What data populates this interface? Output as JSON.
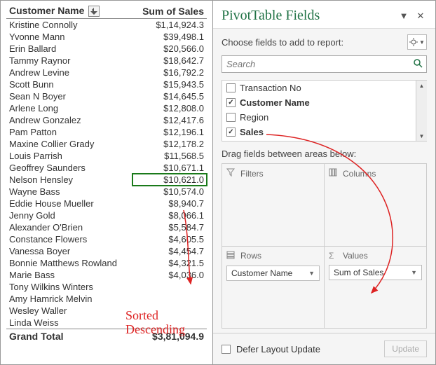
{
  "pivot": {
    "header_name": "Customer Name",
    "header_sales": "Sum of Sales",
    "rows": [
      {
        "name": "Kristine Connolly",
        "value": "$1,14,924.3"
      },
      {
        "name": "Yvonne Mann",
        "value": "$39,498.1"
      },
      {
        "name": "Erin Ballard",
        "value": "$20,566.0"
      },
      {
        "name": "Tammy Raynor",
        "value": "$18,642.7"
      },
      {
        "name": "Andrew Levine",
        "value": "$16,792.2"
      },
      {
        "name": "Scott Bunn",
        "value": "$15,943.5"
      },
      {
        "name": "Sean N Boyer",
        "value": "$14,645.5"
      },
      {
        "name": "Arlene Long",
        "value": "$12,808.0"
      },
      {
        "name": "Andrew Gonzalez",
        "value": "$12,417.6"
      },
      {
        "name": "Pam Patton",
        "value": "$12,196.1"
      },
      {
        "name": "Maxine Collier Grady",
        "value": "$12,178.2"
      },
      {
        "name": "Louis Parrish",
        "value": "$11,568.5"
      },
      {
        "name": "Geoffrey Saunders",
        "value": "$10,671.1"
      },
      {
        "name": "Nelson Hensley",
        "value": "$10,621.0"
      },
      {
        "name": "Wayne Bass",
        "value": "$10,574.0"
      },
      {
        "name": "Eddie House Mueller",
        "value": "$8,940.7"
      },
      {
        "name": "Jenny Gold",
        "value": "$8,066.1"
      },
      {
        "name": "Alexander O'Brien",
        "value": "$5,584.7"
      },
      {
        "name": "Constance Flowers",
        "value": "$4,605.5"
      },
      {
        "name": "Vanessa Boyer",
        "value": "$4,454.7"
      },
      {
        "name": "Bonnie Matthews Rowland",
        "value": "$4,321.5"
      },
      {
        "name": "Marie Bass",
        "value": "$4,036.0"
      },
      {
        "name": "Tony Wilkins Winters",
        "value": ""
      },
      {
        "name": "Amy Hamrick Melvin",
        "value": ""
      },
      {
        "name": "Wesley Waller",
        "value": ""
      },
      {
        "name": "Linda Weiss",
        "value": ""
      }
    ],
    "total_label": "Grand Total",
    "total_value": "$3,81,094.9"
  },
  "panel": {
    "title": "PivotTable Fields",
    "choose_label": "Choose fields to add to report:",
    "search_placeholder": "Search",
    "fields": [
      {
        "label": "Transaction No",
        "checked": false,
        "bold": false
      },
      {
        "label": "Customer Name",
        "checked": true,
        "bold": true
      },
      {
        "label": "Region",
        "checked": false,
        "bold": false
      },
      {
        "label": "Sales",
        "checked": true,
        "bold": true
      }
    ],
    "drag_label": "Drag fields between areas below:",
    "areas": {
      "filters": "Filters",
      "columns": "Columns",
      "rows": "Rows",
      "values": "Values"
    },
    "row_pill": "Customer Name",
    "value_pill": "Sum of Sales",
    "defer_label": "Defer Layout Update",
    "update_label": "Update"
  },
  "annotation": {
    "text1": "Sorted",
    "text2": "Descending"
  }
}
